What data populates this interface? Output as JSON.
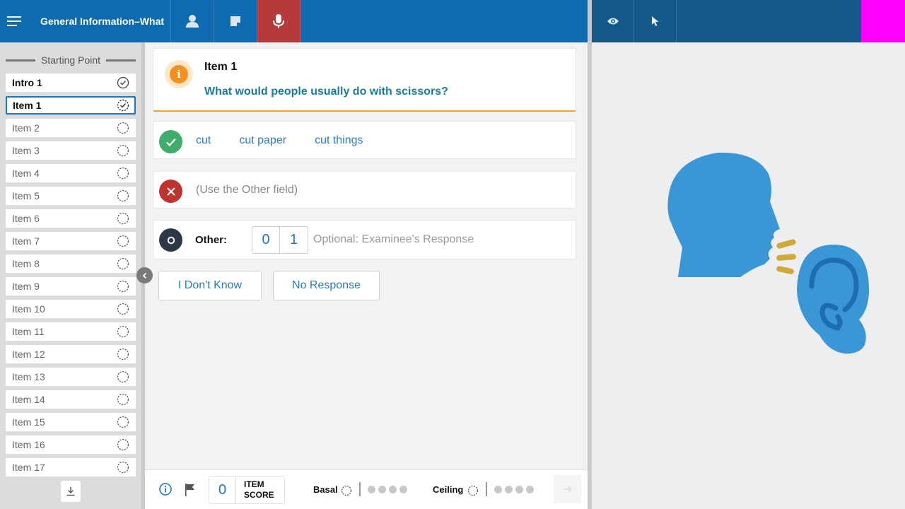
{
  "header": {
    "title": "General Information–What"
  },
  "sidebar": {
    "section_title": "Starting Point",
    "items": [
      {
        "label": "Intro 1",
        "state": "done"
      },
      {
        "label": "Item 1",
        "state": "current"
      },
      {
        "label": "Item 2",
        "state": "pending"
      },
      {
        "label": "Item 3",
        "state": "pending"
      },
      {
        "label": "Item 4",
        "state": "pending"
      },
      {
        "label": "Item 5",
        "state": "pending"
      },
      {
        "label": "Item 6",
        "state": "pending"
      },
      {
        "label": "Item 7",
        "state": "pending"
      },
      {
        "label": "Item 8",
        "state": "pending"
      },
      {
        "label": "Item 9",
        "state": "pending"
      },
      {
        "label": "Item 10",
        "state": "pending"
      },
      {
        "label": "Item 11",
        "state": "pending"
      },
      {
        "label": "Item 12",
        "state": "pending"
      },
      {
        "label": "Item 13",
        "state": "pending"
      },
      {
        "label": "Item 14",
        "state": "pending"
      },
      {
        "label": "Item 15",
        "state": "pending"
      },
      {
        "label": "Item 16",
        "state": "pending"
      },
      {
        "label": "Item 17",
        "state": "pending"
      }
    ]
  },
  "question": {
    "item_label": "Item 1",
    "text": "What would people usually do with scissors?"
  },
  "correct_answers": [
    "cut",
    "cut paper",
    "cut things"
  ],
  "incorrect_note": "(Use the Other field)",
  "other": {
    "label": "Other:",
    "score_options": [
      "0",
      "1"
    ],
    "placeholder": "Optional: Examinee's Response"
  },
  "response_buttons": {
    "dont_know": "I Don't Know",
    "no_response": "No Response"
  },
  "footer": {
    "item_score_value": "0",
    "item_score_label_line1": "ITEM",
    "item_score_label_line2": "SCORE",
    "basal_label": "Basal",
    "ceiling_label": "Ceiling"
  },
  "colors": {
    "header_blue": "#0f6bb0",
    "header_right_blue": "#135a8a",
    "mic_red": "#b73a3a",
    "accent_orange": "#f5901f",
    "question_teal": "#1a7c98",
    "correct_green": "#3eae6a",
    "incorrect_red": "#c0332e",
    "link_blue": "#2a7bc4",
    "magenta": "#ff00ff",
    "illustration_blue": "#3a96d4"
  }
}
